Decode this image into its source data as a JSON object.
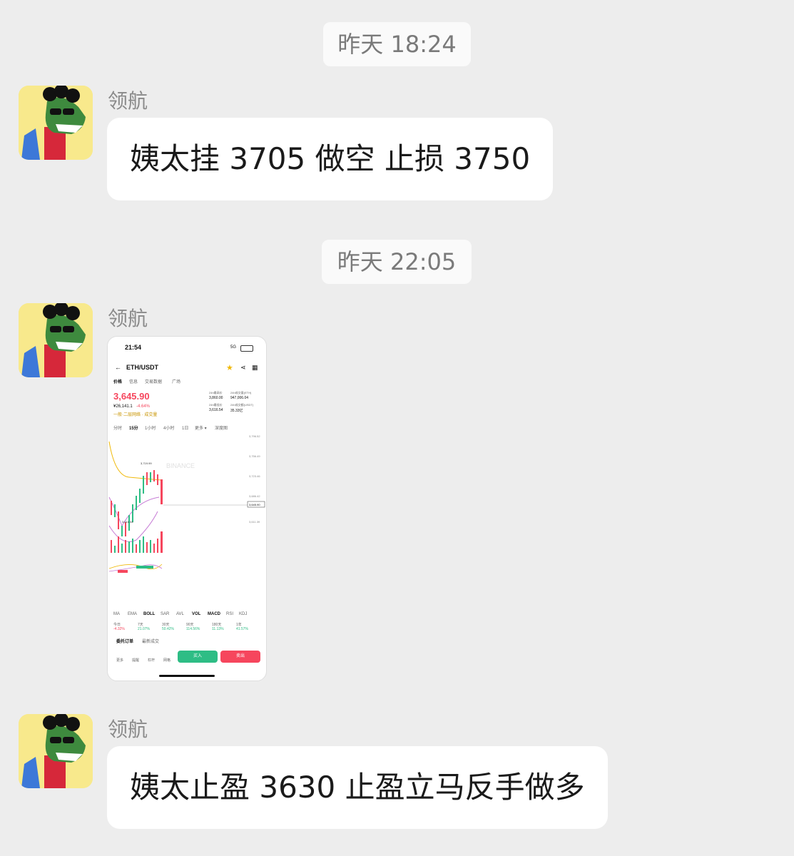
{
  "messages": [
    {
      "type": "time",
      "text": "昨天 18:24"
    },
    {
      "type": "text",
      "sender": "领航",
      "text": "姨太挂 3705 做空 止损 3750"
    },
    {
      "type": "time",
      "text": "昨天 22:05"
    },
    {
      "type": "image",
      "sender": "领航"
    },
    {
      "type": "text",
      "sender": "领航",
      "text": "姨太止盈 3630 止盈立马反手做多"
    }
  ],
  "screenshot": {
    "status_time": "21:54",
    "network": "5G",
    "pair": "ETH/USDT",
    "tabs": [
      "价格",
      "信息",
      "交易数据",
      "广场"
    ],
    "price": "3,645.90",
    "price_cny": "¥26,141.1",
    "change": "-4.64%",
    "tags": "一般·二层网络 · 成交量",
    "stats": [
      {
        "label": "24h最高价",
        "value": "3,860.00"
      },
      {
        "label": "24h成交量(ETH)",
        "value": "947,006.04"
      },
      {
        "label": "24h最低价",
        "value": "3,616.54"
      },
      {
        "label": "24h成交额(USDT)",
        "value": "35.33亿"
      }
    ],
    "intervals": [
      "分时",
      "15分",
      "1小时",
      "4小时",
      "1日",
      "更多 ▾",
      "深度图"
    ],
    "watermark": "BINANCE",
    "y_ticks": [
      "3,796.52",
      "3,756.49",
      "3,723.46",
      "3,686.42",
      "3,645.90",
      "3,611.39"
    ],
    "high_label": "3,719.99",
    "low_label": "3,616.54",
    "indicators": [
      "MA",
      "EMA",
      "BOLL",
      "SAR",
      "AVL",
      "VOL",
      "MACD",
      "RSI",
      "KDJ"
    ],
    "perf_labels": [
      "今日",
      "7天",
      "30天",
      "90天",
      "180天",
      "1年"
    ],
    "perf_values": [
      "-4.32%",
      "21.07%",
      "50.42%",
      "114.56%",
      "11.13%",
      "41.57%"
    ],
    "order_tabs": [
      "委托订单",
      "最新成交"
    ],
    "bottom_icons": [
      "更多",
      "提醒",
      "杠杆",
      "网格"
    ],
    "buy_label": "买入",
    "sell_label": "卖出",
    "colors": {
      "up": "#2ebd85",
      "down": "#f6465d",
      "star": "#f0b90b"
    }
  }
}
